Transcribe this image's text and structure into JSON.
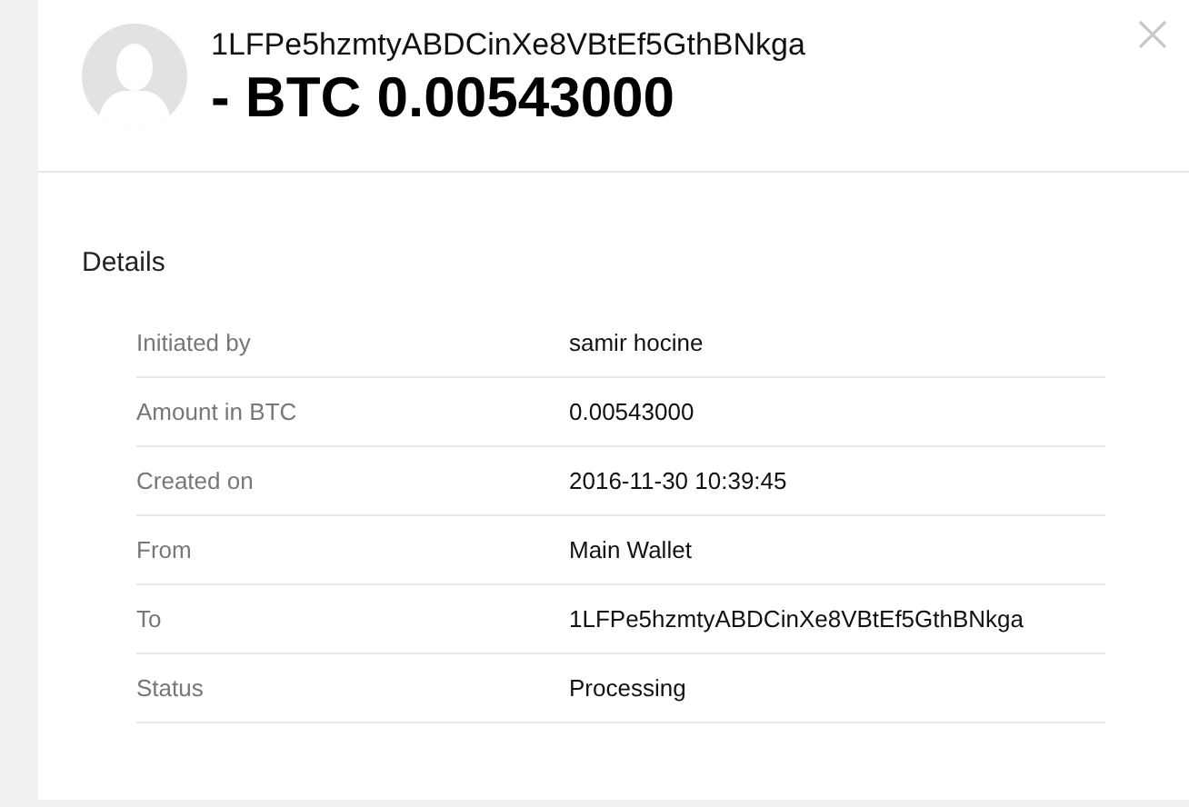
{
  "header": {
    "address": "1LFPe5hzmtyABDCinXe8VBtEf5GthBNkga",
    "amount": "- BTC 0.00543000"
  },
  "details": {
    "title": "Details",
    "rows": [
      {
        "label": "Initiated by",
        "value": "samir hocine"
      },
      {
        "label": "Amount in BTC",
        "value": "0.00543000"
      },
      {
        "label": "Created on",
        "value": "2016-11-30 10:39:45"
      },
      {
        "label": "From",
        "value": "Main Wallet"
      },
      {
        "label": "To",
        "value": "1LFPe5hzmtyABDCinXe8VBtEf5GthBNkga"
      },
      {
        "label": "Status",
        "value": "Processing"
      }
    ]
  }
}
